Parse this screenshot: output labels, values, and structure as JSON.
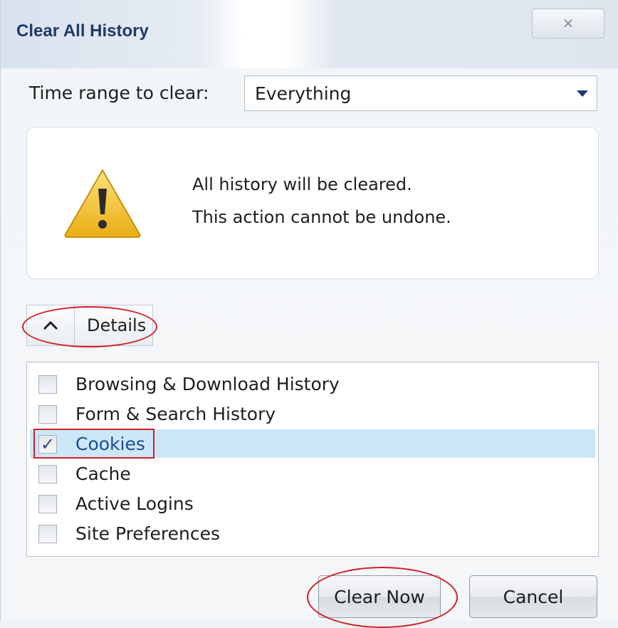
{
  "window": {
    "title": "Clear All History",
    "close_glyph": "✕"
  },
  "time_range": {
    "label": "Time range to clear:",
    "selected": "Everything"
  },
  "warning": {
    "icon": "warning-triangle-icon",
    "line1": "All history will be cleared.",
    "line2": "This action cannot be undone."
  },
  "details": {
    "label": "Details",
    "expanded": true
  },
  "items": [
    {
      "label": "Browsing & Download History",
      "checked": false
    },
    {
      "label": "Form & Search History",
      "checked": false
    },
    {
      "label": "Cookies",
      "checked": true,
      "selected": true
    },
    {
      "label": "Cache",
      "checked": false
    },
    {
      "label": "Active Logins",
      "checked": false
    },
    {
      "label": "Site Preferences",
      "checked": false
    }
  ],
  "buttons": {
    "clear_now": "Clear Now",
    "cancel": "Cancel"
  },
  "colors": {
    "title_text": "#1f3b64",
    "selection": "#cce8f7",
    "annotation_red": "#d21e24",
    "warning_yellow": "#f2c21a"
  }
}
